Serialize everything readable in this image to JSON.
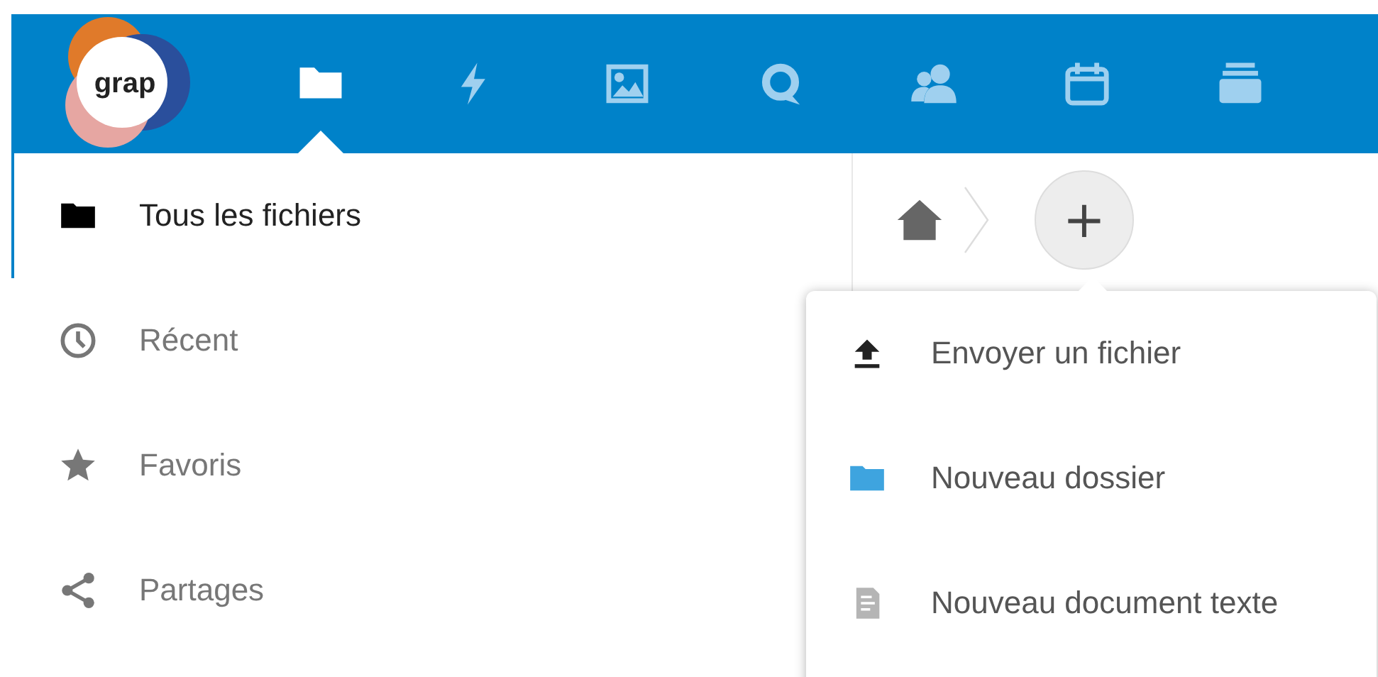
{
  "header": {
    "logo": "grap",
    "apps": [
      {
        "kind": "files",
        "selected": true
      },
      {
        "kind": "activity",
        "selected": false
      },
      {
        "kind": "gallery",
        "selected": false
      },
      {
        "kind": "talk",
        "selected": false
      },
      {
        "kind": "contacts",
        "selected": false
      },
      {
        "kind": "calendar",
        "selected": false
      },
      {
        "kind": "deck",
        "selected": false
      }
    ]
  },
  "sidebar": {
    "items": [
      {
        "label": "Tous les fichiers",
        "kind": "folder",
        "selected": true
      },
      {
        "label": "Récent",
        "kind": "clock",
        "selected": false
      },
      {
        "label": "Favoris",
        "kind": "star",
        "selected": false
      },
      {
        "label": "Partages",
        "kind": "share",
        "selected": false
      }
    ]
  },
  "breadcrumb": {
    "new_button": "+"
  },
  "new_menu": {
    "items": [
      {
        "label": "Envoyer un fichier",
        "kind": "upload"
      },
      {
        "label": "Nouveau dossier",
        "kind": "folder"
      },
      {
        "label": "Nouveau document texte",
        "kind": "text"
      }
    ]
  }
}
